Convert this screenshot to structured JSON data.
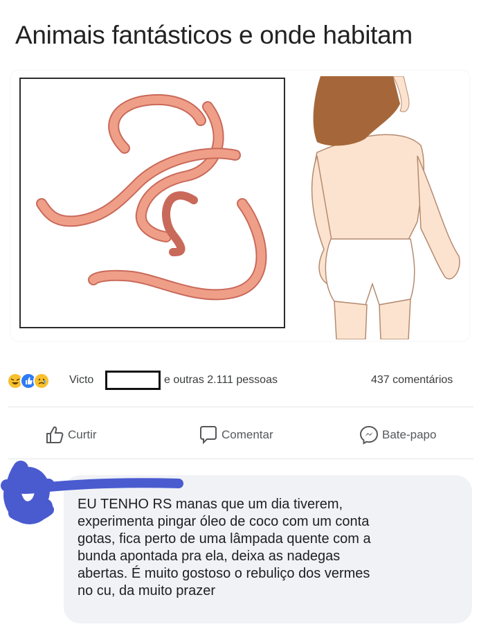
{
  "post": {
    "title": "Animais fantásticos e onde habitam"
  },
  "reactions": {
    "icons": [
      "haha-icon",
      "like-icon",
      "sad-icon"
    ],
    "liker_name_visible": "Victo",
    "liker_rest": "e outras 2.111 pessoas",
    "comments_count": "437 comentários"
  },
  "actions": {
    "like_label": "Curtir",
    "comment_label": "Comentar",
    "chat_label": "Bate-papo"
  },
  "comment": {
    "lines": [
      "EU TENHO RS manas que um dia tiverem,",
      "experimenta pingar óleo de coco com um conta",
      "gotas, fica perto de uma lâmpada quente com a",
      "bunda apontada pra ela, deixa as nadegas",
      "abertas. É muito gostoso o rebuliço dos vermes",
      "no cu, da muito prazer"
    ]
  },
  "colors": {
    "like_blue": "#2e7bf6",
    "reaction_yellow": "#f7c02f",
    "bubble_gray": "#f0f2f5",
    "scribble_blue": "#4a5bd0",
    "worm_pink": "#e9937b"
  }
}
